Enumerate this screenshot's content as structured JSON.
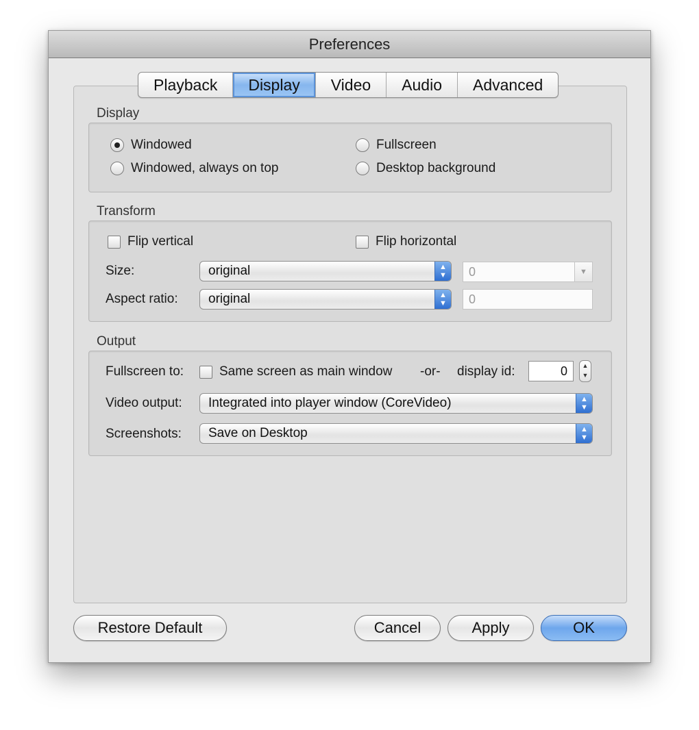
{
  "window": {
    "title": "Preferences"
  },
  "tabs": [
    {
      "label": "Playback",
      "active": false
    },
    {
      "label": "Display",
      "active": true
    },
    {
      "label": "Video",
      "active": false
    },
    {
      "label": "Audio",
      "active": false
    },
    {
      "label": "Advanced",
      "active": false
    }
  ],
  "display": {
    "section_label": "Display",
    "windowed": "Windowed",
    "windowed_on_top": "Windowed, always on top",
    "fullscreen": "Fullscreen",
    "desktop_background": "Desktop background",
    "selected": "Windowed"
  },
  "transform": {
    "section_label": "Transform",
    "flip_vertical": "Flip vertical",
    "flip_horizontal": "Flip horizontal",
    "size_label": "Size:",
    "size_value": "original",
    "size_custom": "0",
    "aspect_label": "Aspect ratio:",
    "aspect_value": "original",
    "aspect_custom": "0"
  },
  "output": {
    "section_label": "Output",
    "fullscreen_to_label": "Fullscreen to:",
    "same_screen": "Same screen as main window",
    "or_text": "-or-",
    "display_id_label": "display id:",
    "display_id_value": "0",
    "video_output_label": "Video output:",
    "video_output_value": "Integrated into player window (CoreVideo)",
    "screenshots_label": "Screenshots:",
    "screenshots_value": "Save on Desktop"
  },
  "buttons": {
    "restore_default": "Restore Default",
    "cancel": "Cancel",
    "apply": "Apply",
    "ok": "OK"
  },
  "colors": {
    "accent": "#5b92d8",
    "window_bg": "#e8e8e8"
  }
}
